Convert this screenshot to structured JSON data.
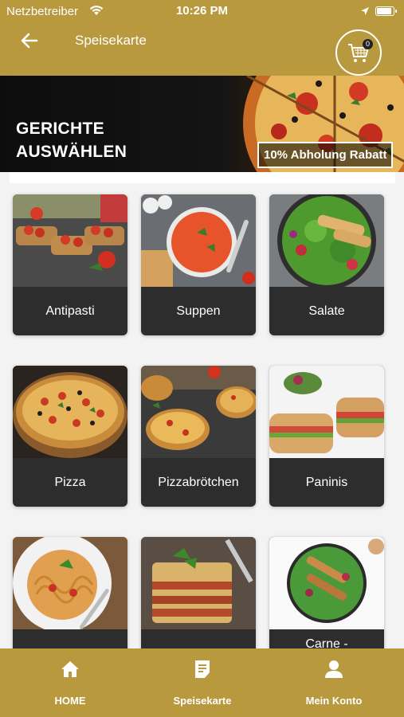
{
  "status_bar": {
    "carrier": "Netzbetreiber",
    "time": "10:26 PM"
  },
  "header": {
    "title": "Speisekarte",
    "cart_count": "0"
  },
  "banner": {
    "title": "GERICHTE\nAUSWÄHLEN",
    "badge": "10% Abholung Rabatt"
  },
  "categories": [
    {
      "label": "Antipasti"
    },
    {
      "label": "Suppen"
    },
    {
      "label": "Salate"
    },
    {
      "label": "Pizza"
    },
    {
      "label": "Pizzabrötchen"
    },
    {
      "label": "Paninis"
    },
    {
      "label": ""
    },
    {
      "label": ""
    },
    {
      "label": "Carne -"
    }
  ],
  "bottom_nav": [
    {
      "label": "HOME",
      "icon": "home-icon"
    },
    {
      "label": "Speisekarte",
      "icon": "menu-list-icon"
    },
    {
      "label": "Mein Konto",
      "icon": "user-icon"
    }
  ],
  "colors": {
    "brand": "#b8993e",
    "card_label_bg": "#2d2d2d",
    "banner_bg": "#111111"
  }
}
